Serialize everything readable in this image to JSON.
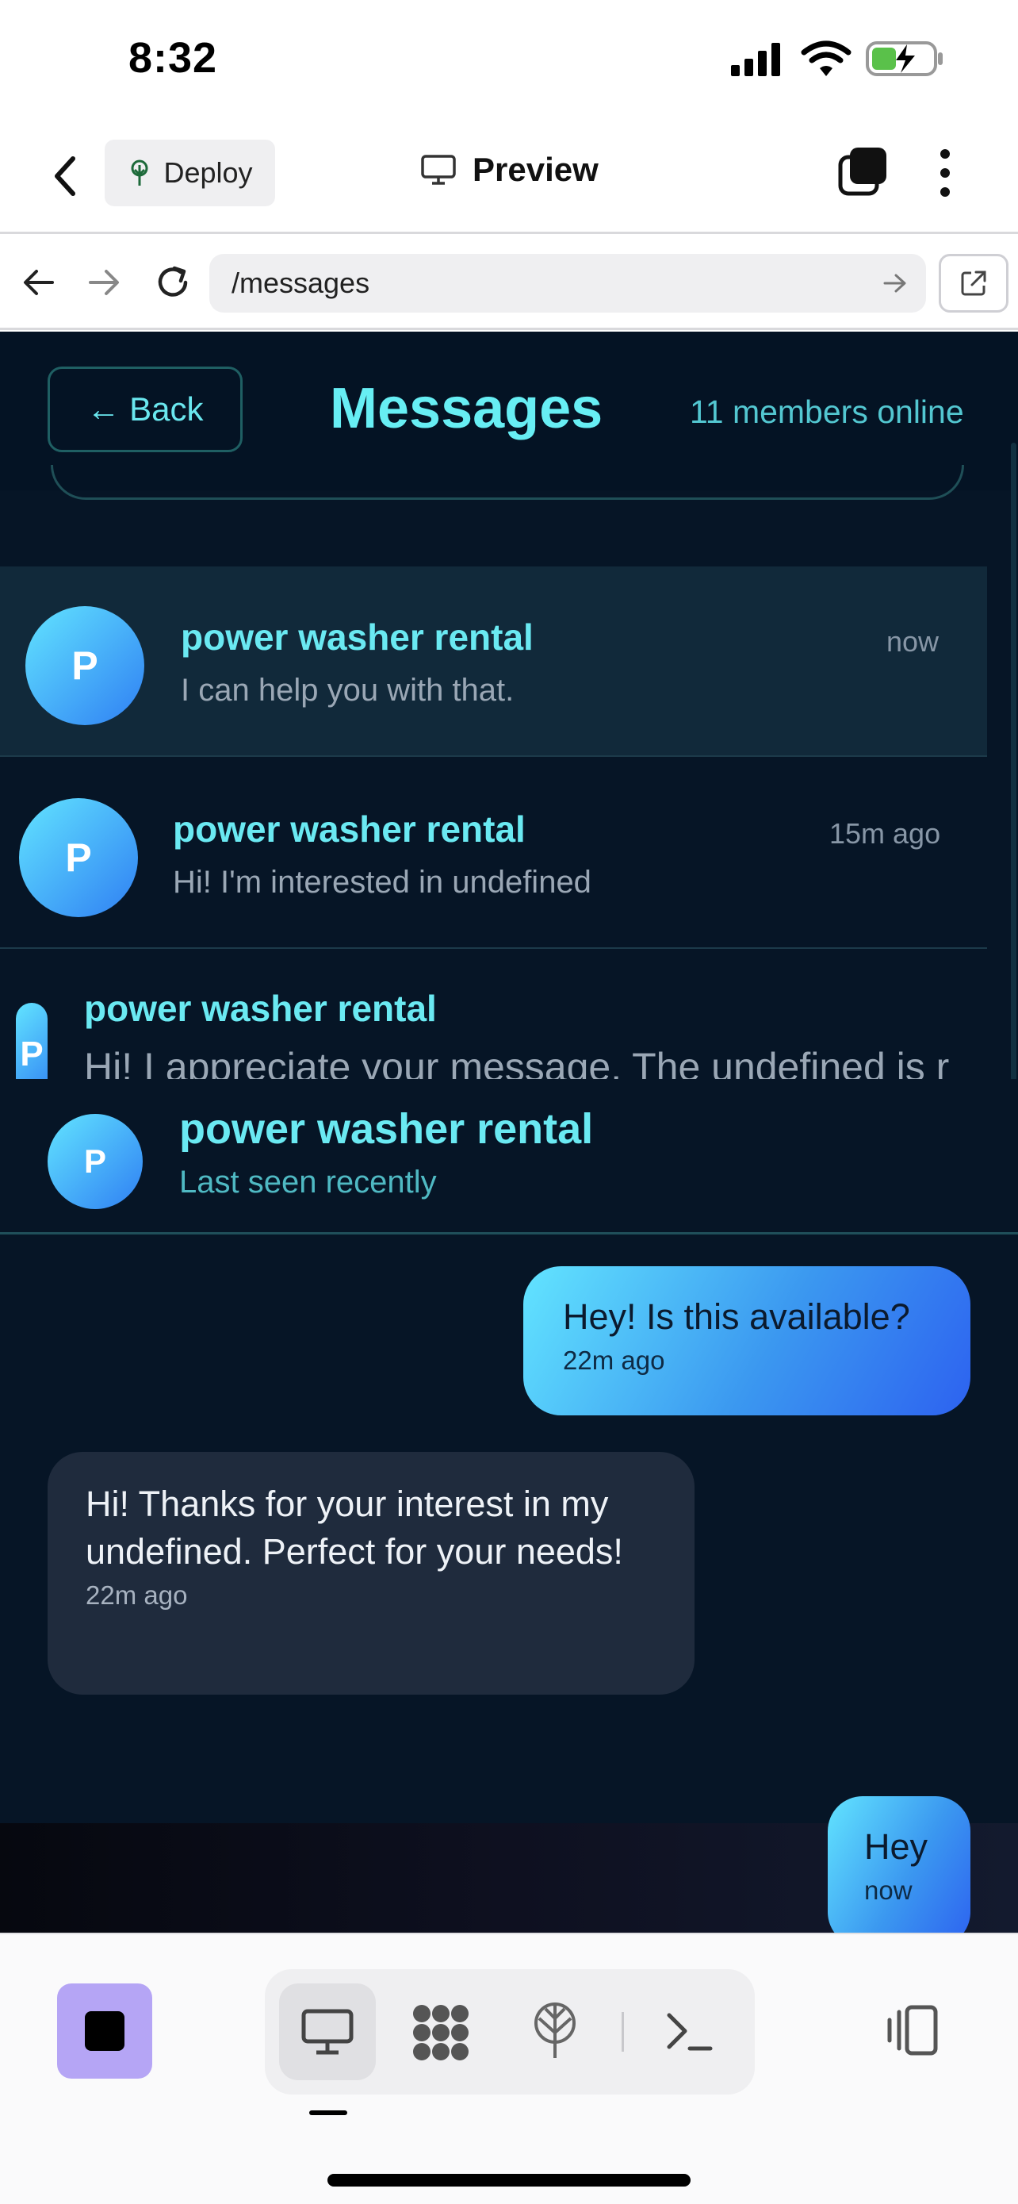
{
  "status_bar": {
    "time": "8:32"
  },
  "app_bar": {
    "deploy_label": "Deploy",
    "preview_label": "Preview"
  },
  "browser": {
    "url": "/messages"
  },
  "messages_page": {
    "back_label": "← Back",
    "title": "Messages",
    "online_count": "11 members online",
    "conversations": [
      {
        "initial": "P",
        "name": "power washer rental",
        "preview": "I can help you with that.",
        "time": "now"
      },
      {
        "initial": "P",
        "name": "power washer rental",
        "preview": "Hi! I'm interested in undefined",
        "time": "15m ago"
      },
      {
        "initial": "P",
        "name": "power washer rental",
        "preview": "Hi! I appreciate your message. The undefined is r",
        "time": ""
      }
    ]
  },
  "chat": {
    "initial": "P",
    "name": "power washer rental",
    "status": "Last seen recently",
    "messages": [
      {
        "direction": "out",
        "text": "Hey! Is this available?",
        "time": "22m ago"
      },
      {
        "direction": "in",
        "text": "Hi! Thanks for your interest in my undefined. Perfect for your needs!",
        "time": "22m ago"
      },
      {
        "direction": "out",
        "text": "Hey",
        "time": "now"
      }
    ]
  },
  "colors": {
    "accent_cyan": "#67eef4",
    "page_bg": "#061526",
    "bubble_gradient_start": "#62e4ff",
    "bubble_gradient_end": "#2d62f0",
    "stop_button": "#b5a5f5"
  },
  "icons": [
    "back-chevron-icon",
    "deploy-tree-icon",
    "monitor-icon",
    "tabs-icon",
    "more-vertical-icon",
    "arrow-left-icon",
    "arrow-right-icon",
    "reload-icon",
    "url-go-icon",
    "open-external-icon",
    "stop-icon",
    "desktop-icon",
    "apps-grid-icon",
    "network-icon",
    "terminal-icon",
    "split-view-icon"
  ]
}
